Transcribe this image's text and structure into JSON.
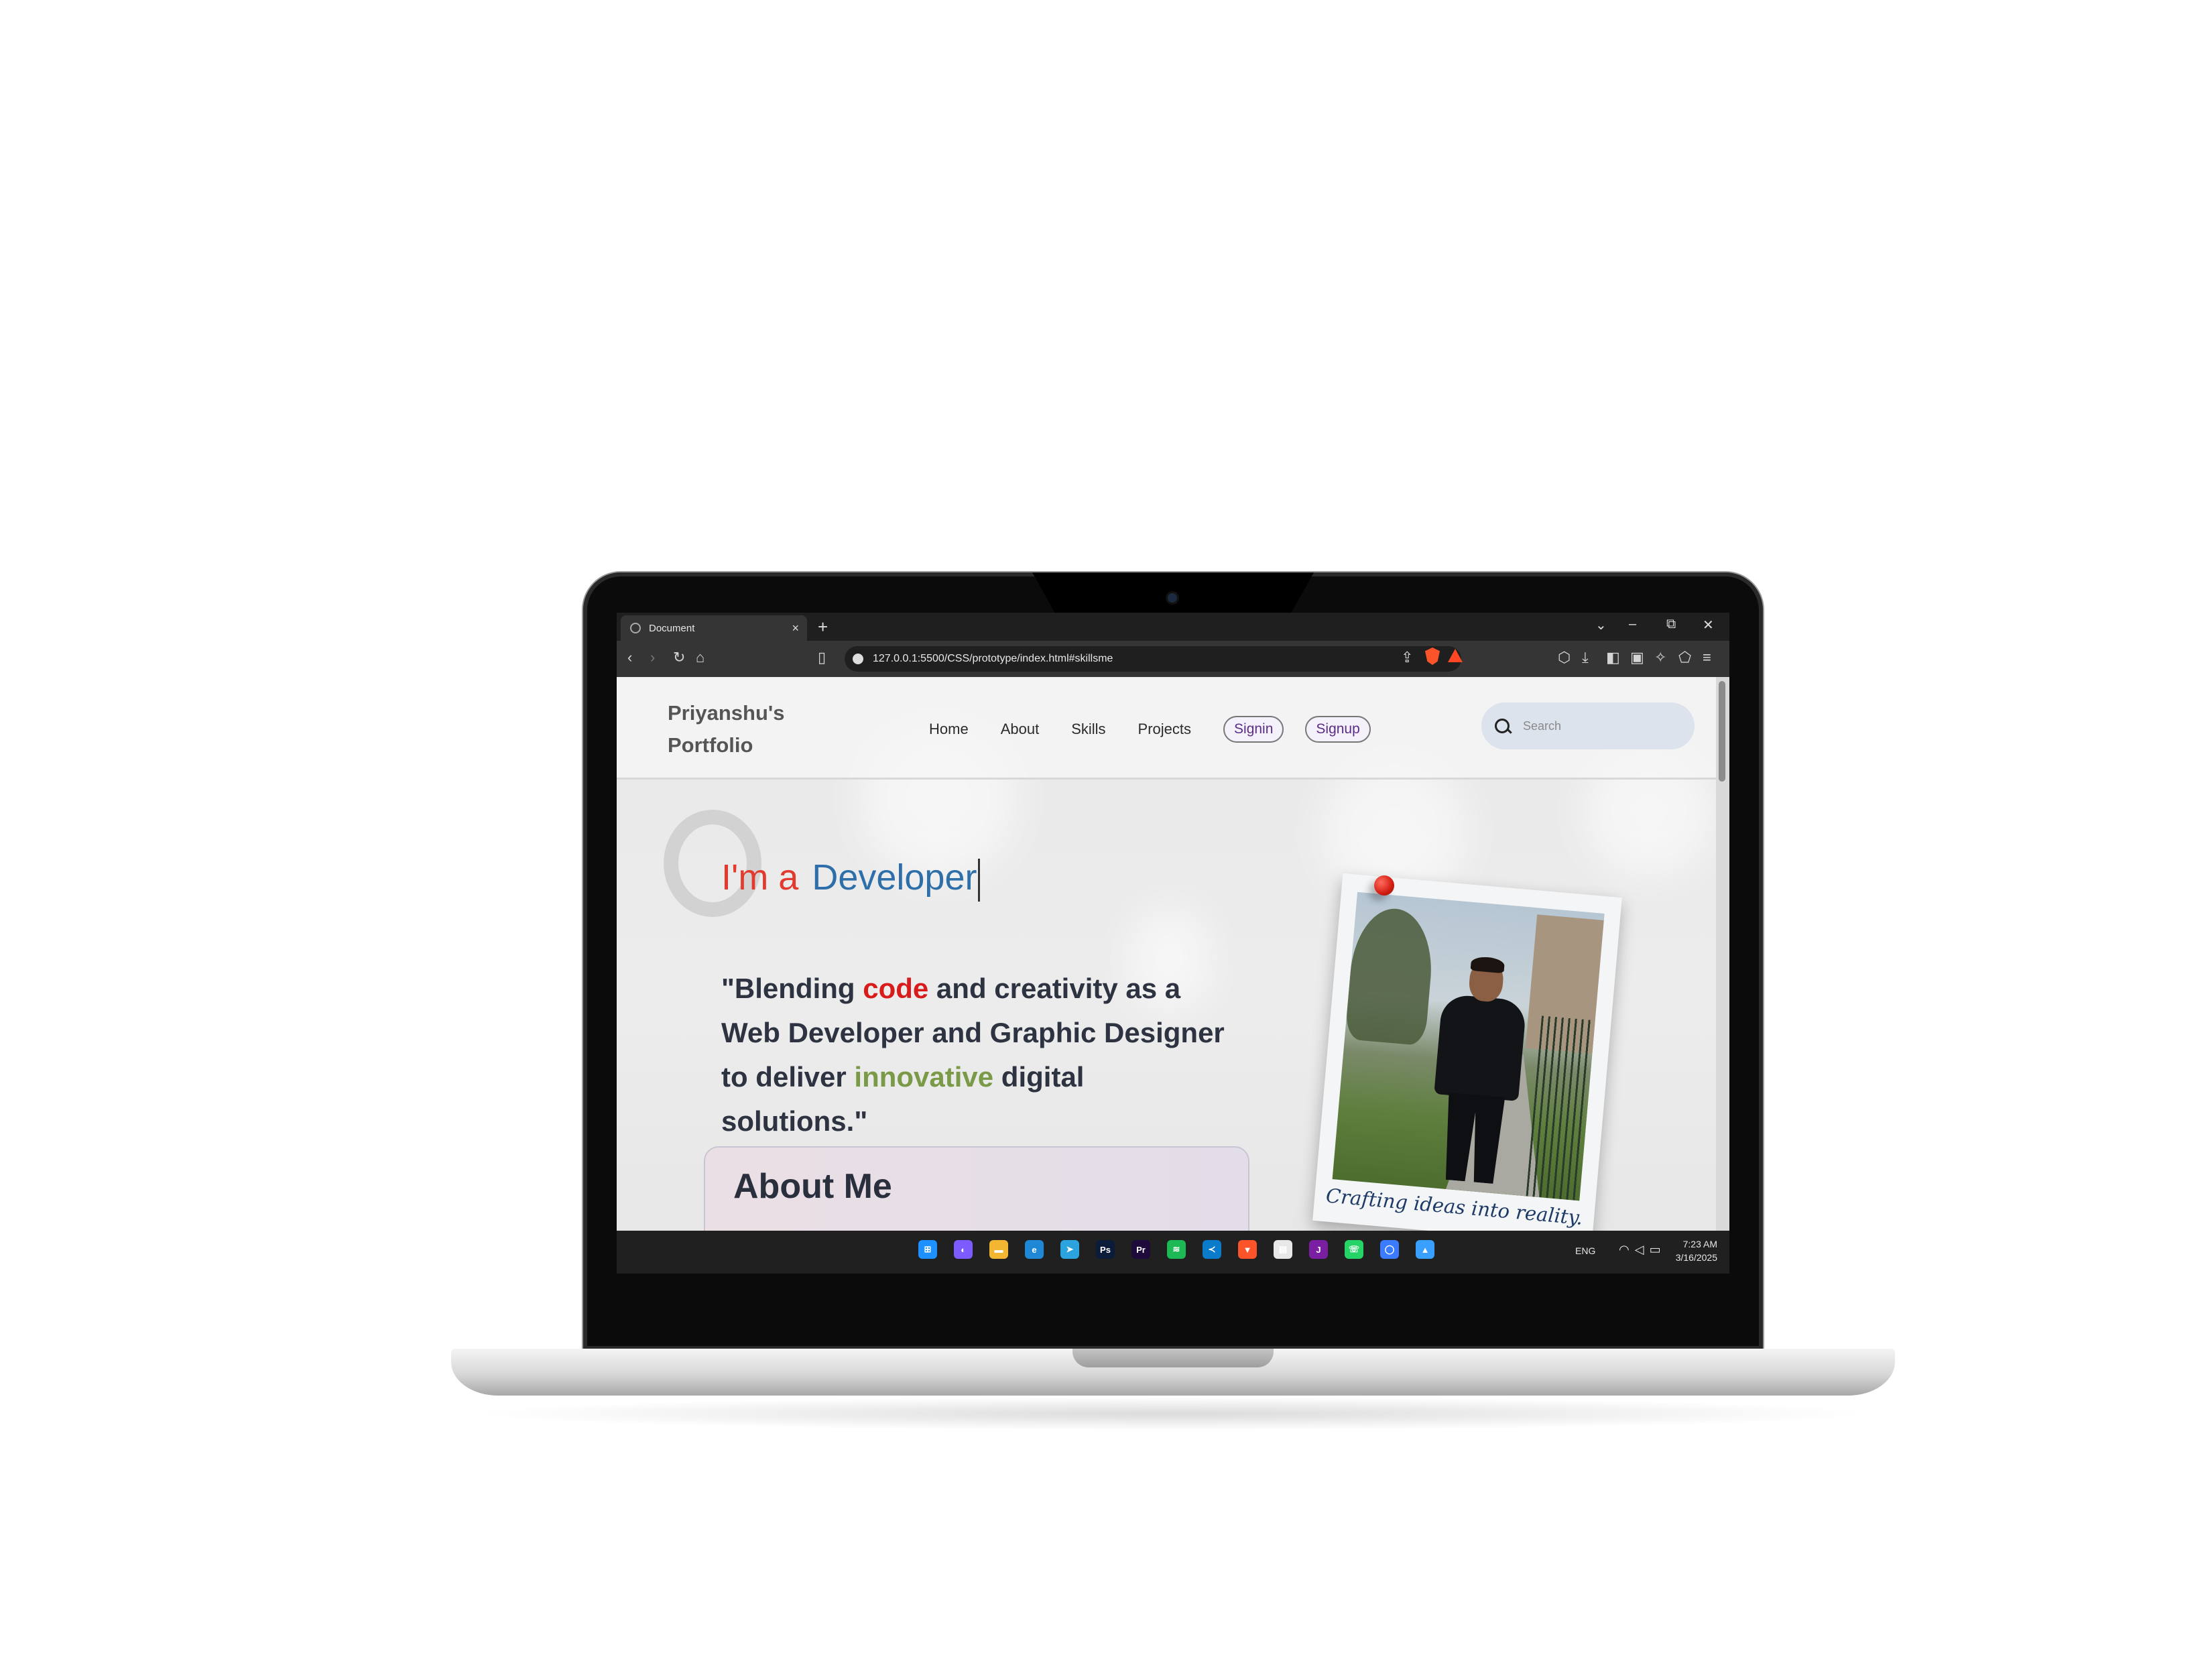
{
  "browser": {
    "tab_title": "Document",
    "tab_close": "×",
    "new_tab": "+",
    "url": "127.0.0.1:5500/CSS/prototype/index.html#skillsme",
    "window_controls": {
      "list": "⌄",
      "minimize": "–",
      "restore": "⧉",
      "close": "✕"
    }
  },
  "site": {
    "brand_line1": "Priyanshu's",
    "brand_line2": "Portfolio",
    "nav": [
      {
        "label": "Home"
      },
      {
        "label": "About"
      },
      {
        "label": "Skills"
      },
      {
        "label": "Projects"
      }
    ],
    "signin_label": "Signin",
    "signup_label": "Signup",
    "search_placeholder": "Search"
  },
  "hero": {
    "prefix": "I'm a",
    "typed_word": "Developer",
    "quote_part1": "\"Blending ",
    "quote_hl1": "code",
    "quote_part2": " and creativity as a Web Developer and Graphic Designer to deliver ",
    "quote_hl2": "innovative",
    "quote_part3": " digital solutions.\"",
    "about_title": "About Me",
    "photo_caption": "Crafting ideas into reality."
  },
  "taskbar": {
    "apps": [
      {
        "name": "windows-start-icon",
        "glyph": "⊞",
        "color": "#1e90ff"
      },
      {
        "name": "copilot-icon",
        "glyph": "◐",
        "color": "#7c5cff"
      },
      {
        "name": "file-explorer-icon",
        "glyph": "▬",
        "color": "#f2b632"
      },
      {
        "name": "edge-icon",
        "glyph": "e",
        "color": "#1e88d6"
      },
      {
        "name": "telegram-icon",
        "glyph": "➤",
        "color": "#2aa3de"
      },
      {
        "name": "photoshop-icon",
        "glyph": "Ps",
        "color": "#0b1c3b"
      },
      {
        "name": "premiere-icon",
        "glyph": "Pr",
        "color": "#1e0b3b"
      },
      {
        "name": "spotify-icon",
        "glyph": "≋",
        "color": "#1db954"
      },
      {
        "name": "vscode-icon",
        "glyph": "≺",
        "color": "#0a7acb"
      },
      {
        "name": "brave-icon",
        "glyph": "▼",
        "color": "#fb542b"
      },
      {
        "name": "store-icon",
        "glyph": "▤",
        "color": "#e8e8e8"
      },
      {
        "name": "jetbrains-icon",
        "glyph": "J",
        "color": "#7b1fa2"
      },
      {
        "name": "whatsapp-icon",
        "glyph": "☏",
        "color": "#25d366"
      },
      {
        "name": "cortana-icon",
        "glyph": "◯",
        "color": "#3a7bff"
      },
      {
        "name": "app-icon",
        "glyph": "▲",
        "color": "#3aa0ff"
      }
    ],
    "language": "ENG",
    "time": "7:23 AM",
    "date": "3/16/2025"
  }
}
